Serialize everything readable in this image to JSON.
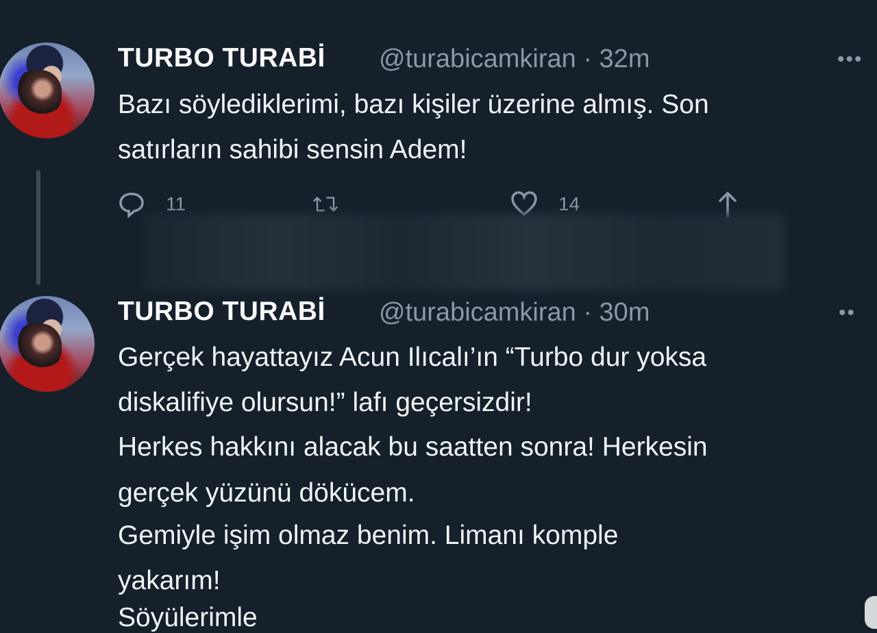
{
  "tweets": [
    {
      "name": "TURBO TURABİ",
      "handle": "@turabicamkiran · 32m",
      "more": "•••",
      "lines": [
        "Bazı söylediklerimi, bazı kişiler üzerine almış. Son",
        "satırların sahibi sensin Adem!"
      ],
      "actions": {
        "reply_count": "11",
        "retweet_count": "",
        "like_count": "14"
      }
    },
    {
      "name": "TURBO TURABİ",
      "handle": "@turabicamkiran · 30m",
      "more": "••",
      "lines": [
        "Gerçek hayattayız Acun Ilıcalı’ın “Turbo dur yoksa",
        "diskalifiye olursun!” lafı geçersizdir!",
        "Herkes hakkını alacak bu saatten sonra! Herkesin",
        "gerçek yüzünü dökücem.",
        "Gemiyle işim olmaz benim. Limanı komple",
        "yakarım!",
        "Söyülerimle"
      ]
    }
  ],
  "icons": {
    "reply": "reply-icon",
    "retweet": "retweet-icon",
    "like": "heart-icon",
    "share": "share-icon",
    "more": "more-icon"
  },
  "colors": {
    "background": "#15202b",
    "text": "#f2f4f5",
    "secondary": "#8b98a5"
  }
}
